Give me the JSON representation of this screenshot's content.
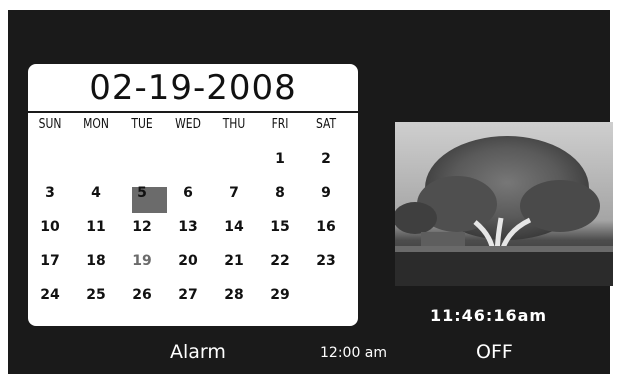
{
  "calendar": {
    "date": "02-19-2008",
    "weekdays": [
      "SUN",
      "MON",
      "TUE",
      "WED",
      "THU",
      "FRI",
      "SAT"
    ],
    "weeks": [
      [
        "",
        "",
        "",
        "",
        "",
        "1",
        "2"
      ],
      [
        "3",
        "4",
        "5",
        "6",
        "7",
        "8",
        "9"
      ],
      [
        "10",
        "11",
        "12",
        "13",
        "14",
        "15",
        "16"
      ],
      [
        "17",
        "18",
        "19",
        "20",
        "21",
        "22",
        "23"
      ],
      [
        "24",
        "25",
        "26",
        "27",
        "28",
        "29",
        ""
      ]
    ],
    "selected_day": "19"
  },
  "photo": {
    "icon": "tree-photo"
  },
  "clock": {
    "time": "11:46:16am"
  },
  "alarm": {
    "label": "Alarm",
    "time": "12:00 am",
    "state": "OFF"
  },
  "colors": {
    "background": "#1a1a1a",
    "calendar": "#ffffff",
    "selected": "#6b6b6b",
    "text": "#ffffff"
  }
}
